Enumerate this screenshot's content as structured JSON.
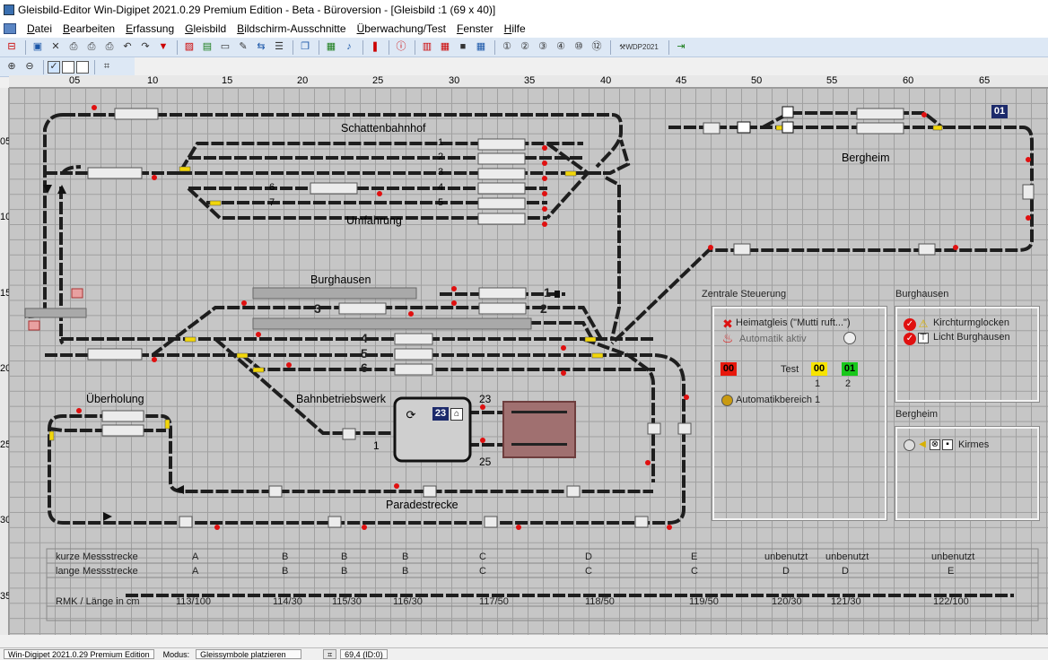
{
  "window": {
    "title": "Gleisbild-Editor Win-Digipet 2021.0.29 Premium Edition - Beta - Büroversion - [Gleisbild :1 (69 x 40)]"
  },
  "menu": [
    "Datei",
    "Bearbeiten",
    "Erfassung",
    "Gleisbild",
    "Bildschirm-Ausschnitte",
    "Überwachung/Test",
    "Fenster",
    "Hilfe"
  ],
  "toolbar": {
    "wdp_label": "WDP2021"
  },
  "ruler": {
    "top": [
      "05",
      "10",
      "15",
      "20",
      "25",
      "30",
      "35",
      "40",
      "45",
      "50",
      "55",
      "60",
      "65"
    ],
    "left": [
      "05",
      "10",
      "15",
      "20",
      "25",
      "30",
      "35"
    ]
  },
  "labels": {
    "schattenbahnhof": "Schattenbahnhof",
    "umfahrung": "Umfahrung",
    "bergheim": "Bergheim",
    "burghausen": "Burghausen",
    "bahnbetriebswerk": "Bahnbetriebswerk",
    "ueberholung": "Überholung",
    "paradestrecke": "Paradestrecke"
  },
  "track_numbers": {
    "sbf": [
      "1",
      "2",
      "3",
      "4",
      "5",
      "6",
      "7"
    ],
    "burg": [
      "1",
      "2",
      "3",
      "4",
      "5",
      "6"
    ],
    "bw": [
      "23",
      "1",
      "25"
    ],
    "bw_box": "23",
    "bergheim_box": "01"
  },
  "zentrale": {
    "title": "Zentrale Steuerung",
    "heimatgleis": "Heimatgleis (\"Mutti ruft...\")",
    "automatik_aktiv": "Automatik aktiv",
    "test_label": "Test",
    "badges": [
      "00",
      "00",
      "01"
    ],
    "test_nums": [
      "1",
      "2"
    ],
    "automatik_bereich": "Automatikbereich 1",
    "colors": {
      "red": "#e8180c",
      "yellow": "#f7e400",
      "green": "#17c81a"
    }
  },
  "burghausen_panel": {
    "title": "Burghausen",
    "items": [
      "Kirchturmglocken",
      "Licht Burghausen"
    ]
  },
  "bergheim_panel": {
    "title": "Bergheim",
    "item": "Kirmes"
  },
  "messtrecke": {
    "row1_label": "kurze Messstrecke",
    "row1": [
      "A",
      "B",
      "B",
      "B",
      "C",
      "D",
      "E",
      "unbenutzt",
      "unbenutzt",
      "unbenutzt"
    ],
    "row2_label": "lange Messstrecke",
    "row2": [
      "A",
      "B",
      "B",
      "B",
      "C",
      "C",
      "C",
      "D",
      "D",
      "E"
    ],
    "row3_label": "RMK / Länge in cm",
    "row3": [
      "113/100",
      "114/30",
      "115/30",
      "116/30",
      "117/50",
      "118/50",
      "119/50",
      "120/30",
      "121/30",
      "122/100"
    ]
  },
  "status": {
    "edition": "Win-Digipet 2021.0.29 Premium Edition",
    "modus_label": "Modus:",
    "modus_value": "Gleissymbole platzieren",
    "coords": "69,4 (ID:0)"
  }
}
